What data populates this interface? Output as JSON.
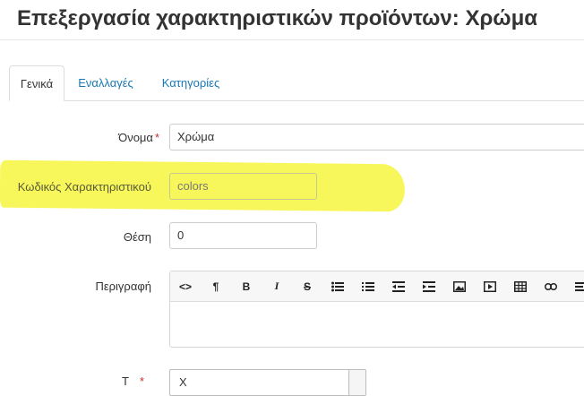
{
  "page": {
    "title": "Επεξεργασία χαρακτηριστικών προϊόντων: Χρώμα"
  },
  "tabs": [
    {
      "label": "Γενικά",
      "active": true
    },
    {
      "label": "Εναλλαγές",
      "active": false
    },
    {
      "label": "Κατηγορίες",
      "active": false
    }
  ],
  "form": {
    "name": {
      "label": "Όνομα",
      "required_mark": "*",
      "value": "Χρώμα"
    },
    "code": {
      "label": "Κωδικός Χαρακτηριστικού",
      "value": "colors"
    },
    "position": {
      "label": "Θέση",
      "value": "0"
    },
    "description": {
      "label": "Περιγραφή"
    },
    "partial_field": {
      "label": "Τ",
      "required_mark": "*",
      "value": "Χ"
    }
  },
  "editor_toolbar": [
    {
      "icon": "code-view-icon",
      "glyph": "<>"
    },
    {
      "icon": "paragraph-icon",
      "glyph": "¶"
    },
    {
      "icon": "bold-icon",
      "glyph": "B"
    },
    {
      "icon": "italic-icon",
      "glyph": "I"
    },
    {
      "icon": "strikethrough-icon",
      "glyph": "S"
    },
    {
      "icon": "unordered-list-icon",
      "glyph": ""
    },
    {
      "icon": "ordered-list-icon",
      "glyph": ""
    },
    {
      "icon": "outdent-icon",
      "glyph": ""
    },
    {
      "icon": "indent-icon",
      "glyph": ""
    },
    {
      "icon": "image-icon",
      "glyph": ""
    },
    {
      "icon": "video-icon",
      "glyph": ""
    },
    {
      "icon": "table-icon",
      "glyph": ""
    },
    {
      "icon": "link-icon",
      "glyph": ""
    },
    {
      "icon": "align-icon",
      "glyph": ""
    }
  ],
  "colors": {
    "highlight": "#f6f63e",
    "link": "#1a78b4",
    "required": "#c9302c"
  }
}
